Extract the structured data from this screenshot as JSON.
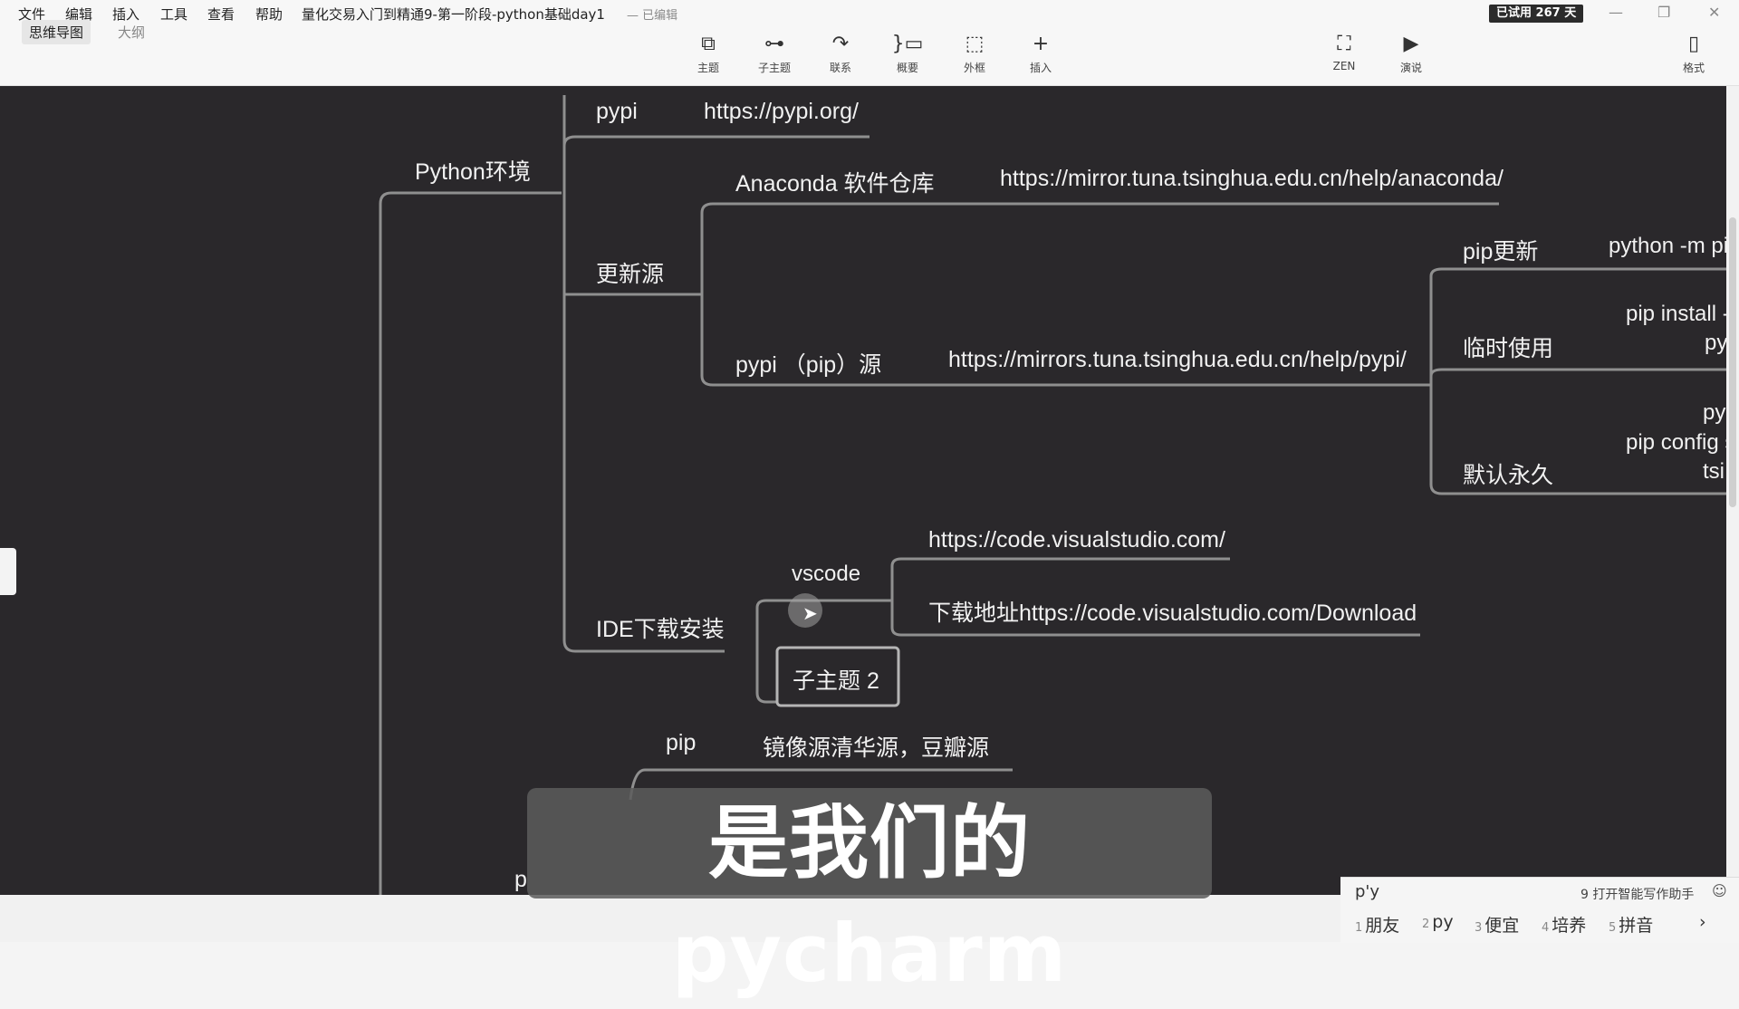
{
  "menu": [
    "文件",
    "编辑",
    "插入",
    "工具",
    "查看",
    "帮助"
  ],
  "doc_title": "量化交易入门到精通9-第一阶段-python基础day1",
  "doc_status": "— 已编辑",
  "trial": "已试用 267 天",
  "window_controls": {
    "minimize": "—",
    "maximize": "❐",
    "close": "✕"
  },
  "view_tabs": {
    "mindmap": "思维导图",
    "outline": "大纲"
  },
  "tools": [
    {
      "icon": "topic-icon",
      "glyph": "⧉",
      "label": "主题"
    },
    {
      "icon": "subtopic-icon",
      "glyph": "⊶",
      "label": "子主题"
    },
    {
      "icon": "relationship-icon",
      "glyph": "↷",
      "label": "联系"
    },
    {
      "icon": "summary-icon",
      "glyph": "}▭",
      "label": "概要"
    },
    {
      "icon": "boundary-icon",
      "glyph": "⬚",
      "label": "外框"
    },
    {
      "icon": "insert-icon",
      "glyph": "+",
      "label": "插入"
    }
  ],
  "right_tools": [
    {
      "icon": "zen-icon",
      "glyph": "⛶",
      "label": "ZEN"
    },
    {
      "icon": "presentation-icon",
      "glyph": "▶",
      "label": "演说"
    },
    {
      "icon": "panel-icon",
      "glyph": "▯",
      "label": "格式"
    }
  ],
  "nodes": {
    "pypi": "pypi",
    "pypi_url": "https://pypi.org/",
    "python_env": "Python环境",
    "anaconda_repo": "Anaconda 软件仓库",
    "anaconda_url": "https://mirror.tuna.tsinghua.edu.cn/help/anaconda/",
    "update_source": "更新源",
    "pip_update": "pip更新",
    "pip_update_cmd": "python -m pip",
    "temp_use": "临时使用",
    "temp_cmd1": "pip install -",
    "temp_cmd2": "py",
    "pypi_pip_source": "pypi （pip）源",
    "pypi_mirror_url": "https://mirrors.tuna.tsinghua.edu.cn/help/pypi/",
    "default_permanent": "默认永久",
    "perm_cmd1": "py",
    "perm_cmd2": "pip config s",
    "perm_cmd3": "tsi",
    "vscode": "vscode",
    "vscode_url": "https://code.visualstudio.com/",
    "vscode_download": "下载地址https://code.visualstudio.com/Download",
    "ide_install": "IDE下载安装",
    "subtopic2": "子主题 2",
    "pip": "pip",
    "pip_mirror": "镜像源清华源，豆瓣源",
    "partial_p": "p"
  },
  "subtitle": "是我们的pycharm",
  "ime": {
    "input": "p'y",
    "assist": "9 打开智能写作助手",
    "candidates": [
      {
        "num": "1",
        "text": "朋友"
      },
      {
        "num": "2",
        "text": "py"
      },
      {
        "num": "3",
        "text": "便宜"
      },
      {
        "num": "4",
        "text": "培养"
      },
      {
        "num": "5",
        "text": "拼音"
      }
    ],
    "next": "›"
  }
}
